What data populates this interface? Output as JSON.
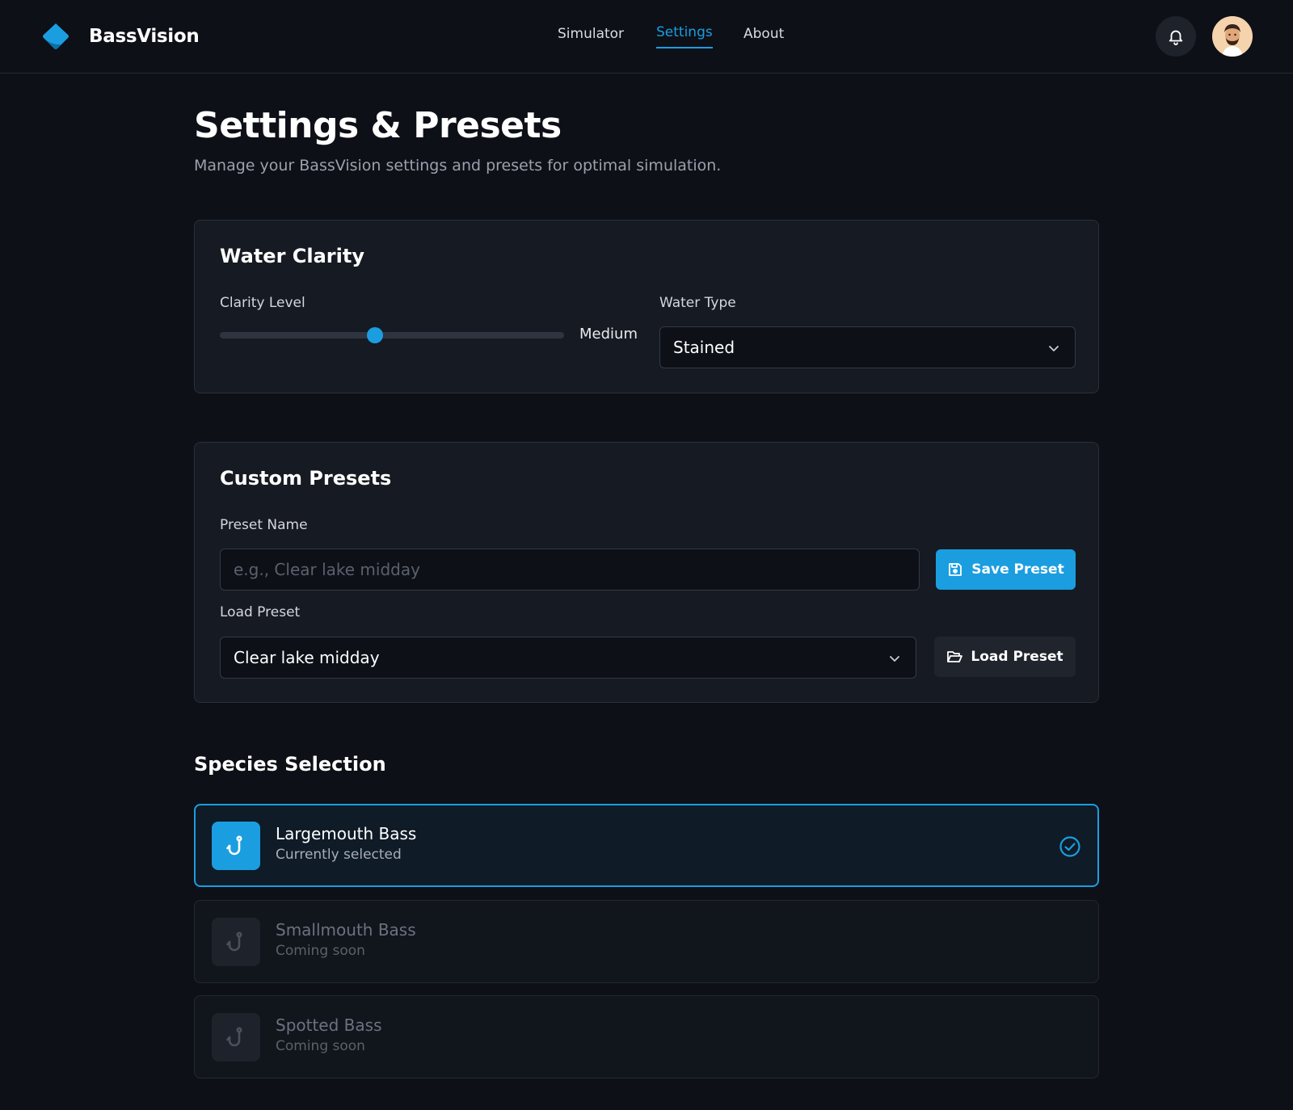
{
  "app": {
    "name": "BassVision"
  },
  "nav": {
    "items": [
      {
        "label": "Simulator"
      },
      {
        "label": "Settings",
        "active": true
      },
      {
        "label": "About"
      }
    ]
  },
  "page": {
    "title": "Settings & Presets",
    "subtitle": "Manage your BassVision settings and presets for optimal simulation."
  },
  "clarity": {
    "title": "Water Clarity",
    "level_label": "Clarity Level",
    "level_value": "Medium",
    "level_fraction": 0.45,
    "water_type_label": "Water Type",
    "water_type_value": "Stained"
  },
  "presets": {
    "title": "Custom Presets",
    "name_label": "Preset Name",
    "name_placeholder": "e.g., Clear lake midday",
    "save_label": "Save Preset",
    "load_label": "Load Preset",
    "load_value": "Clear lake midday",
    "load_button_label": "Load Preset"
  },
  "species": {
    "title": "Species Selection",
    "items": [
      {
        "name": "Largemouth Bass",
        "status": "Currently selected",
        "selected": true
      },
      {
        "name": "Smallmouth Bass",
        "status": "Coming soon",
        "selected": false
      },
      {
        "name": "Spotted Bass",
        "status": "Coming soon",
        "selected": false
      }
    ]
  },
  "colors": {
    "accent": "#1a9ee0",
    "background": "#0d1017",
    "card": "#161a22"
  },
  "icons": [
    "brand-logo-icon",
    "bell-icon",
    "avatar",
    "chevron-down-icon",
    "save-icon",
    "folder-open-icon",
    "fish-hook-icon",
    "check-circle-icon"
  ]
}
